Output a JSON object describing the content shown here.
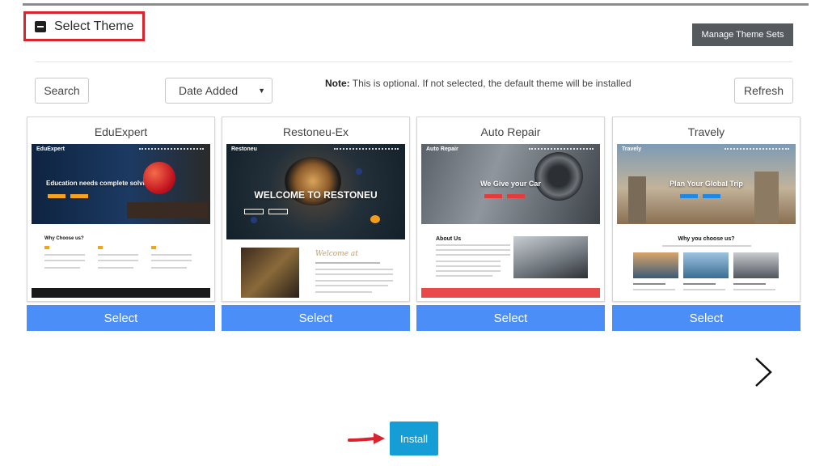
{
  "header": {
    "title": "Select Theme",
    "manage_label": "Manage Theme Sets"
  },
  "toolbar": {
    "search_label": "Search",
    "sort": {
      "selected": "Date Added"
    },
    "note_label": "Note:",
    "note_text": " This is optional. If not selected, the default theme will be installed",
    "refresh_label": "Refresh"
  },
  "themes": [
    {
      "name": "EduExpert",
      "preview_brand": "EduExpert",
      "preview_headline": "Education needs complete solving",
      "preview_section": "Why Choose us?",
      "select_label": "Select"
    },
    {
      "name": "Restoneu-Ex",
      "preview_brand": "Restoneu",
      "preview_headline": "WELCOME TO RESTONEU",
      "preview_section": "Welcome at",
      "select_label": "Select"
    },
    {
      "name": "Auto Repair",
      "preview_brand": "Auto Repair",
      "preview_headline": "We Give your Car",
      "preview_section": "About Us",
      "select_label": "Select"
    },
    {
      "name": "Travely",
      "preview_brand": "Travely",
      "preview_headline": "Plan Your Global Trip",
      "preview_section": "Why you choose us?",
      "select_label": "Select"
    }
  ],
  "footer": {
    "install_label": "Install"
  },
  "colors": {
    "select_button": "#4c8ef7",
    "install_button": "#159dd6",
    "highlight_border": "#d9232e",
    "manage_button": "#555a5f"
  },
  "icons": {
    "collapse": "minus-square-icon",
    "next": "chevron-right-icon",
    "pointer": "arrow-right-icon",
    "sort_caret": "caret-down-icon"
  }
}
